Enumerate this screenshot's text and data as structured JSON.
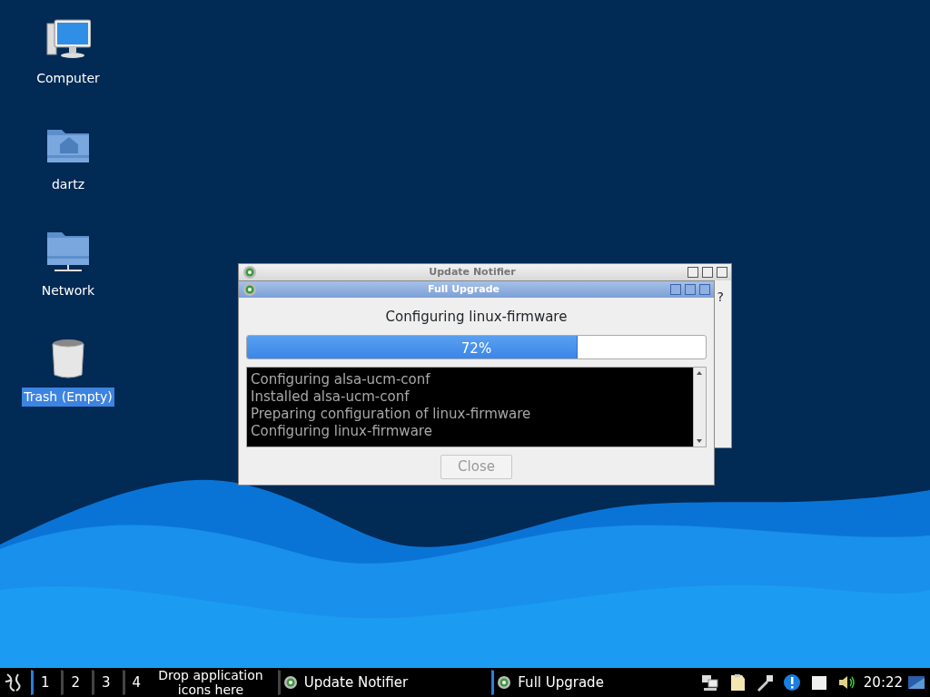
{
  "desktop_icons": [
    {
      "kind": "computer",
      "label": "Computer",
      "selected": false
    },
    {
      "kind": "home",
      "label": "dartz",
      "selected": false
    },
    {
      "kind": "network",
      "label": "Network",
      "selected": false
    },
    {
      "kind": "trash",
      "label": "Trash (Empty)",
      "selected": true
    }
  ],
  "windows": [
    {
      "kind": "notifier",
      "title": "Update Notifier",
      "active": false,
      "fragment": "?"
    },
    {
      "kind": "upgrade",
      "title": "Full Upgrade",
      "active": true,
      "heading": "Configuring linux-firmware",
      "progress": {
        "level": 0.72,
        "reading": "72%"
      },
      "log": [
        "Configuring alsa-ucm-conf",
        "Installed alsa-ucm-conf",
        "Preparing configuration of linux-firmware",
        "Configuring linux-firmware"
      ],
      "close_button": {
        "label": "Close",
        "disabled": true
      }
    }
  ],
  "taskbar": {
    "workspaces": [
      {
        "label": "1",
        "selected": true
      },
      {
        "label": "2",
        "selected": false
      },
      {
        "label": "3",
        "selected": false
      },
      {
        "label": "4",
        "selected": false
      }
    ],
    "launcher_hint": "Drop application icons here",
    "tasks": [
      {
        "label": "Update Notifier",
        "selected": false
      },
      {
        "label": "Full Upgrade",
        "selected": true
      }
    ],
    "clock": "20:22"
  }
}
